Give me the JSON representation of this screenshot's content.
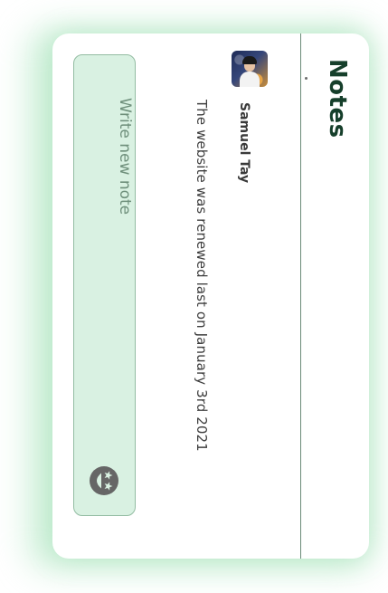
{
  "header": {
    "title": "Notes"
  },
  "note": {
    "author": "Samuel Tay",
    "text": "The website was renewed last on January 3rd 2021",
    "avatar_icon": "profile-photo"
  },
  "composer": {
    "placeholder": "Write new note",
    "emoji_icon": "star-struck-emoji-icon"
  },
  "colors": {
    "accent": "#163f2b",
    "composer_bg": "#d9f1e2",
    "composer_border": "#93bca2",
    "glow": "#aae6be"
  }
}
